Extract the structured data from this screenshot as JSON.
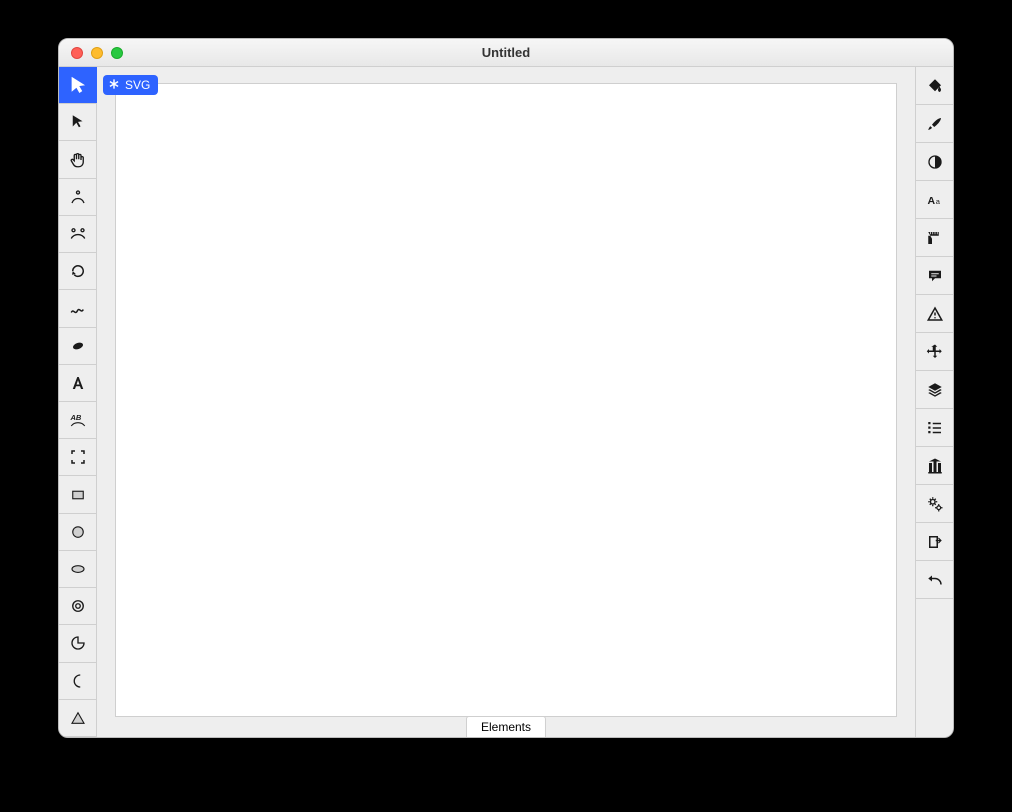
{
  "window": {
    "title": "Untitled"
  },
  "badge": {
    "label": "SVG"
  },
  "bottom": {
    "tab": "Elements"
  },
  "left_tools": [
    {
      "name": "select-tool",
      "icon": "cursor"
    },
    {
      "name": "direct-select-tool",
      "icon": "cursor2"
    },
    {
      "name": "hand-tool",
      "icon": "hand"
    },
    {
      "name": "anchor-point-tool",
      "icon": "anchor"
    },
    {
      "name": "node-tool",
      "icon": "nodes"
    },
    {
      "name": "rotate-tool",
      "icon": "rotate"
    },
    {
      "name": "pencil-tool",
      "icon": "pencil"
    },
    {
      "name": "blob-tool",
      "icon": "blob"
    },
    {
      "name": "text-tool",
      "icon": "textA"
    },
    {
      "name": "text-path-tool",
      "icon": "textpath"
    },
    {
      "name": "artboard-tool",
      "icon": "artboard"
    },
    {
      "name": "rectangle-tool",
      "icon": "rect"
    },
    {
      "name": "circle-tool",
      "icon": "circle"
    },
    {
      "name": "ellipse-tool",
      "icon": "ellipse"
    },
    {
      "name": "target-tool",
      "icon": "target"
    },
    {
      "name": "pie-tool",
      "icon": "pie"
    },
    {
      "name": "moon-tool",
      "icon": "moon"
    },
    {
      "name": "triangle-tool",
      "icon": "triangle"
    }
  ],
  "right_tools": [
    {
      "name": "fill-panel",
      "icon": "paintbucket"
    },
    {
      "name": "stroke-panel",
      "icon": "brush"
    },
    {
      "name": "contrast-panel",
      "icon": "contrast"
    },
    {
      "name": "typography-panel",
      "icon": "typography"
    },
    {
      "name": "ruler-panel",
      "icon": "ruler"
    },
    {
      "name": "comment-panel",
      "icon": "comment"
    },
    {
      "name": "warning-panel",
      "icon": "warning"
    },
    {
      "name": "transform-panel",
      "icon": "move"
    },
    {
      "name": "layers-panel",
      "icon": "layers"
    },
    {
      "name": "list-panel",
      "icon": "list"
    },
    {
      "name": "library-panel",
      "icon": "library"
    },
    {
      "name": "settings-panel",
      "icon": "gears"
    },
    {
      "name": "export-panel",
      "icon": "export"
    },
    {
      "name": "undo-panel",
      "icon": "undo"
    }
  ]
}
